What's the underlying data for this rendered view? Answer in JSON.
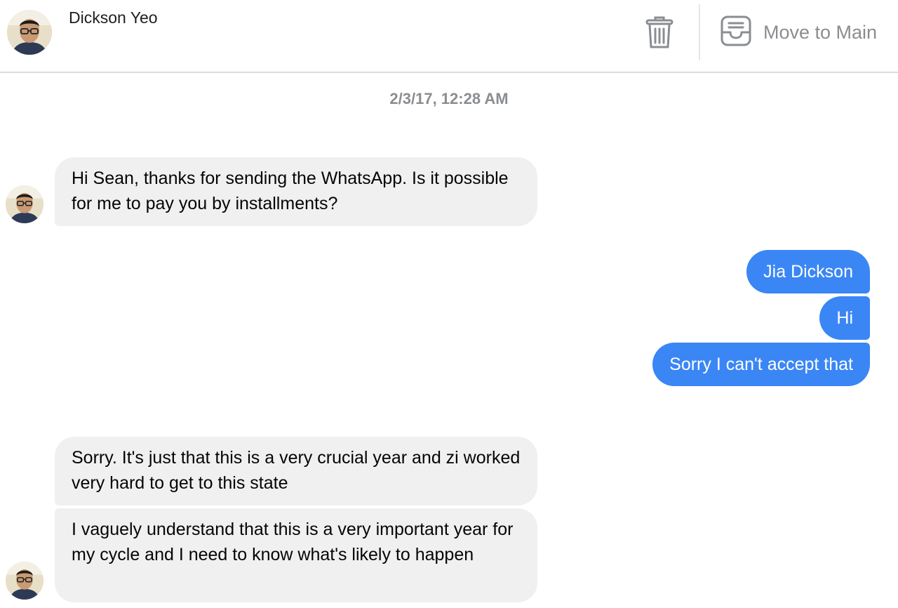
{
  "header": {
    "contact_name": "Dickson Yeo",
    "move_to_main_label": "Move to Main",
    "trash_icon": "trash-icon",
    "inbox_icon": "inbox-tray-icon"
  },
  "conversation": {
    "timestamp": "2/3/17, 12:28 AM",
    "messages": [
      {
        "direction": "incoming",
        "text": "Hi Sean, thanks for sending the WhatsApp. Is it possible for me to pay you by installments?"
      },
      {
        "direction": "outgoing",
        "text": "Jia Dickson"
      },
      {
        "direction": "outgoing",
        "text": "Hi"
      },
      {
        "direction": "outgoing",
        "text": "Sorry I can't accept that"
      },
      {
        "direction": "incoming",
        "text": "Sorry. It's just that this is a very crucial year and zi worked very hard to get to this state"
      },
      {
        "direction": "incoming",
        "text": "I vaguely understand that this is a very important year for my cycle and I need to know what's likely to happen"
      }
    ]
  },
  "colors": {
    "outgoing_bubble": "#3a86f5",
    "incoming_bubble": "#f0f0f0",
    "muted_text": "#8a8d91"
  }
}
